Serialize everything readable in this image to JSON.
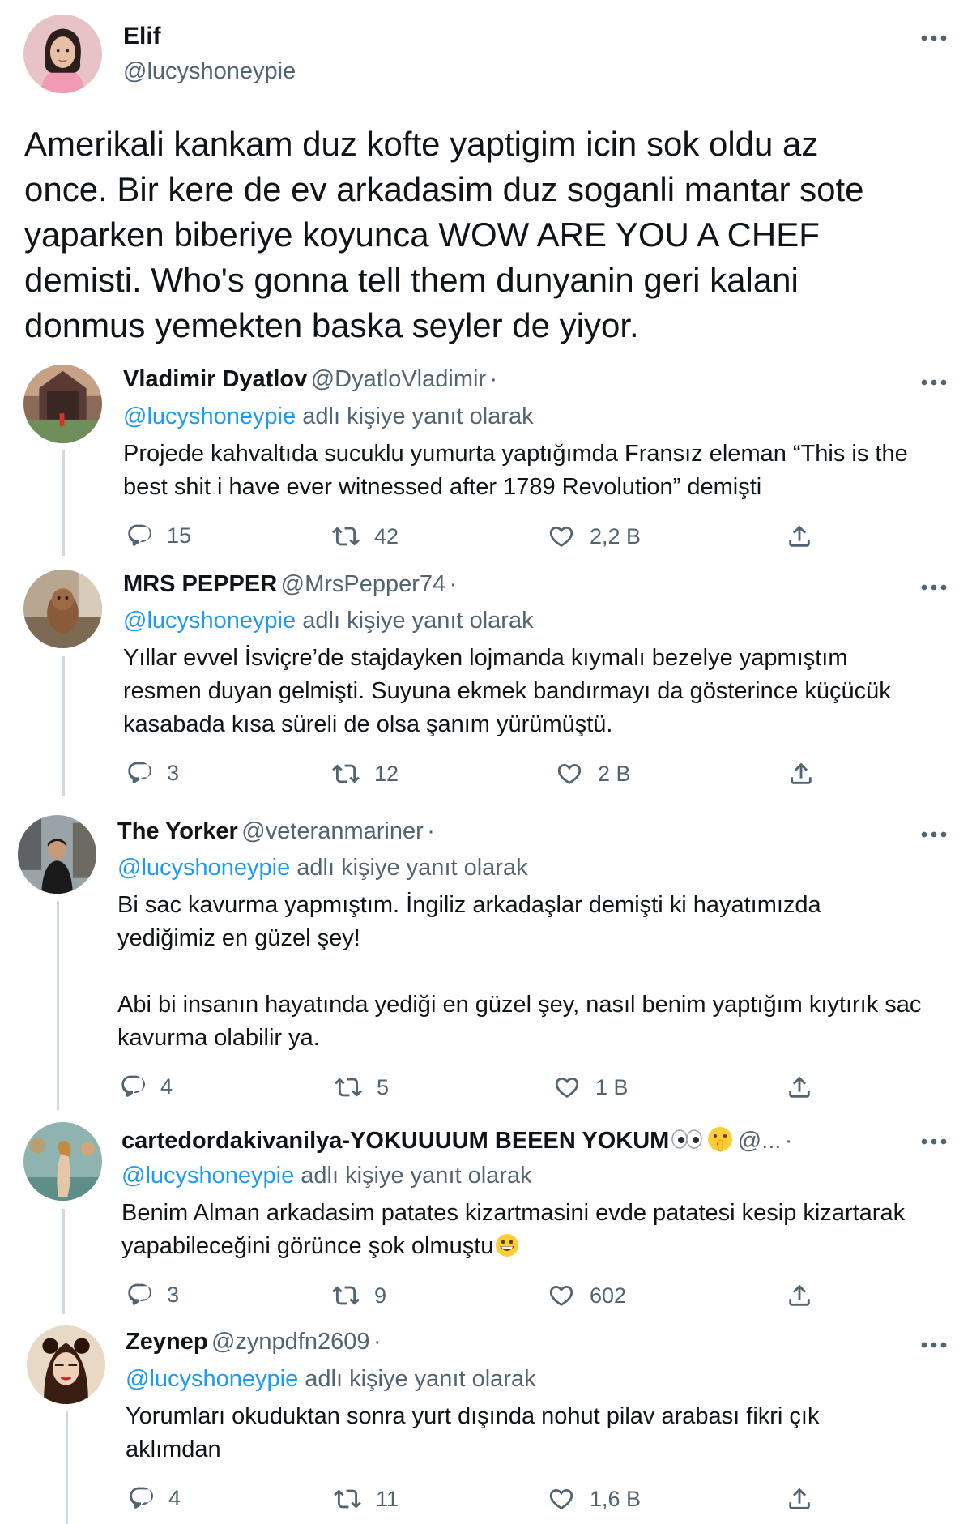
{
  "main_tweet": {
    "name": "Elif",
    "handle": "@lucyshoneypie",
    "text_lines": [
      "Amerikali kankam duz kofte yaptigim icin sok oldu az",
      "once. Bir kere de ev arkadasim duz soganli mantar sote",
      "yaparken biberiye koyunca WOW ARE YOU A CHEF",
      "demisti. Who's gonna tell them dunyanin geri kalani",
      "donmus yemekten baska seyler de yiyor."
    ]
  },
  "reply_suffix": "adlı kişiye yanıt olarak",
  "replies": [
    {
      "name": "Vladimir Dyatlov",
      "handle": "@DyatloVladimir",
      "dot": "·",
      "reply_to": "@lucyshoneypie",
      "text_lines": [
        "Projede kahvaltıda sucuklu yumurta yaptığımda Fransız eleman “This is the",
        "best shit i have ever witnessed after 1789 Revolution” demişti"
      ],
      "replies": "15",
      "retweets": "42",
      "likes": "2,2 B"
    },
    {
      "name": "MRS PEPPER",
      "handle": "@MrsPepper74",
      "dot": "·",
      "reply_to": "@lucyshoneypie",
      "text_lines": [
        "Yıllar evvel İsviçre’de stajdayken lojmanda kıymalı bezelye yapmıştım",
        "resmen duyan gelmişti. Suyuna ekmek bandırmayı da gösterince küçücük",
        "kasabada kısa süreli de olsa şanım yürümüştü."
      ],
      "replies": "3",
      "retweets": "12",
      "likes": "2 B"
    },
    {
      "name": "The Yorker",
      "handle": "@veteranmariner",
      "dot": "·",
      "reply_to": "@lucyshoneypie",
      "text_lines": [
        "Bi sac kavurma yapmıştım. İngiliz arkadaşlar demişti ki hayatımızda",
        "yediğimiz en güzel şey!",
        "",
        "Abi bi insanın hayatında yediği en güzel şey, nasıl benim yaptığım kıytırık sac",
        "kavurma olabilir ya."
      ],
      "replies": "4",
      "retweets": "5",
      "likes": "1 B"
    },
    {
      "name": "cartedordakivanilya-YOKUUUUM BEEEN YOKUM",
      "handle": "@...",
      "dot": "·",
      "reply_to": "@lucyshoneypie",
      "text_lines": [
        "Benim Alman arkadasim patates kizartmasini evde patatesi kesip kizartarak",
        "yapabileceğini görünce şok olmuştu"
      ],
      "replies": "3",
      "retweets": "9",
      "likes": "602"
    },
    {
      "name": "Zeynep",
      "handle": "@zynpdfn2609",
      "dot": "·",
      "reply_to": "@lucyshoneypie",
      "text_lines": [
        "Yorumları okuduktan sonra yurt dışında nohut pilav arabası fikri çık",
        "aklımdan"
      ],
      "replies": "4",
      "retweets": "11",
      "likes": "1,6 B"
    }
  ],
  "icons": {
    "more": "more-horizontal-icon",
    "reply": "reply-icon",
    "retweet": "retweet-icon",
    "like": "like-heart-icon",
    "share": "share-icon",
    "eyes": "eyes-emoji",
    "shush": "shushing-face-emoji",
    "grin": "grinning-face-emoji"
  },
  "colors": {
    "link": "#1d9bf0",
    "muted": "#536471",
    "text": "#0f1419",
    "thread": "#cfd9de"
  }
}
